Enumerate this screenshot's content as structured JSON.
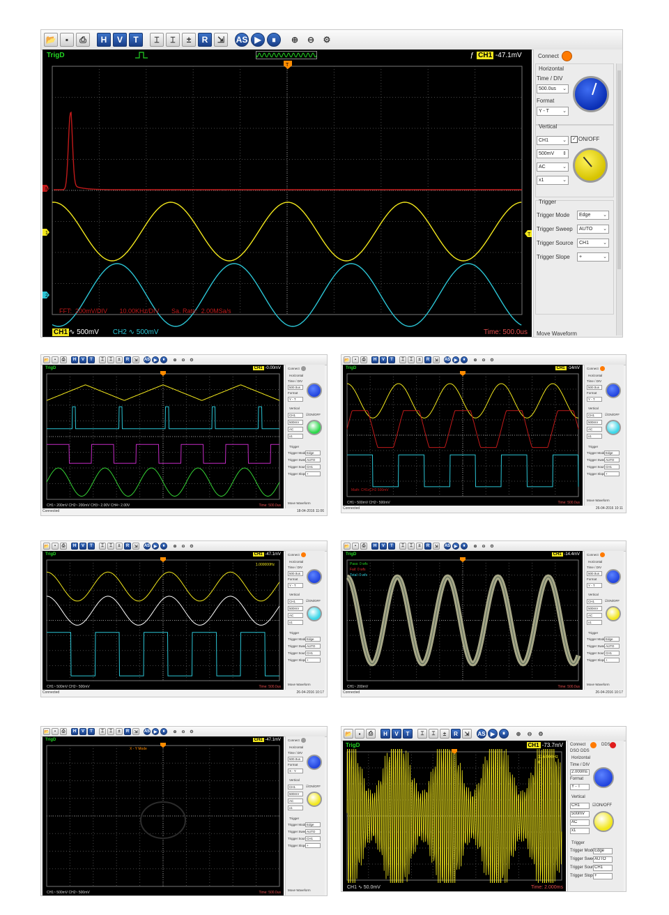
{
  "app": {
    "toolbar_icons": [
      "open-icon",
      "save-icon",
      "print-icon",
      "horizontal-icon",
      "vertical-icon",
      "trigger-icon",
      "cursor1-icon",
      "cursor2-icon",
      "math-icon",
      "ref-icon",
      "measure-icon",
      "auto-set-icon",
      "run-icon",
      "stop-icon",
      "zoom-in-icon",
      "zoom-out-icon",
      "settings-icon"
    ],
    "toolbar_letters": {
      "horizontal": "H",
      "vertical": "V",
      "trigger": "T",
      "ref": "R",
      "auto": "AS"
    }
  },
  "colors": {
    "ch1": "#f2e71c",
    "ch2": "#2bc4d4",
    "ch3": "#c32bc4",
    "ch4": "#35d335",
    "math": "#c01a1a",
    "grid": "#4a4a4a",
    "connect_orange": "#ff7a00"
  },
  "main": {
    "status": {
      "trigd": "TrigD",
      "trigger_readout": "CH1 -47.1mV"
    },
    "bottom": {
      "ch1": "CH1",
      "ch1_scale": "∿ 500mV",
      "ch2": "CH2 ∿ 500mV",
      "time": "Time: 500.0us"
    },
    "fft_text": "FFT:  200mV/DIV       10.00KHz/DIV       Sa. Rate:  2.00MSa/s",
    "side": {
      "connect": "Connect",
      "horizontal": "Horizontal",
      "time_div_label": "Time / DIV",
      "time_div_value": "500.0us",
      "format_label": "Format",
      "format_value": "Y - T",
      "vertical": "Vertical",
      "channel_value": "CH1",
      "onoff": "ON/OFF",
      "volt_value": "500mV",
      "coupling_value": "AC",
      "probe_value": "x1",
      "trigger": "Trigger",
      "trigger_mode_label": "Trigger Mode",
      "trigger_mode_value": "Edge",
      "trigger_sweep_label": "Trigger Sweep",
      "trigger_sweep_value": "AUTO",
      "trigger_source_label": "Trigger Source",
      "trigger_source_value": "CH1",
      "trigger_slope_label": "Trigger Slope",
      "trigger_slope_value": "+",
      "move_waveform": "Move Waveform"
    },
    "markers": {
      "ch1": "1",
      "ch2": "2",
      "math": "M",
      "trigger": "T"
    }
  },
  "thumbs": [
    {
      "connected": "Connected",
      "date": "18-04-2016  11:06",
      "bottom": "CH1~ 200mV   CH2~ 200mV   CH3~ 2.00V   CH4~ 2.00V",
      "time": "Time: 500.0us",
      "trig": "CH1 -0.00mV",
      "overlay": ""
    },
    {
      "connected": "Connected",
      "date": "26-04-2016  10:11",
      "bottom": "CH1~ 500mV   CH2~ 500mV",
      "time": "Time: 500.0us",
      "trig": "CH1 -14mV",
      "overlay": "Math: CH1xCH2 500mV"
    },
    {
      "connected": "Connected",
      "date": "26-04-2016  10:17",
      "bottom": "CH1~ 500mV   CH2~ 500mV",
      "time": "Time: 500.0us",
      "trig": "CH1 -47.1mV",
      "overlay": "1.000000Hz"
    },
    {
      "connected": "Connected",
      "date": "26-04-2016  10:17",
      "bottom": "CH1~ 200mV",
      "time": "Time: 500.0us",
      "trig": "CH1 -14.4mV",
      "overlay": "Pass: 0 wfs\nFail: 0 wfs\nTotal: 0 wfs"
    },
    {
      "connected": "",
      "date": "",
      "bottom": "CH1~ 500mV   CH2~ 500mV",
      "time": "Time: 500.0us",
      "trig": "CH1 -47.1mV",
      "overlay": "X - Y Mode"
    },
    {
      "connected": "",
      "date": "",
      "bottom": "CH1 ∿ 50.0mV",
      "time": "Time: 2.000ms",
      "trig": "CH1 -73.7mV",
      "overlay": "316.000Hz\n0",
      "dso": "DSO",
      "dds": "DDS"
    }
  ]
}
